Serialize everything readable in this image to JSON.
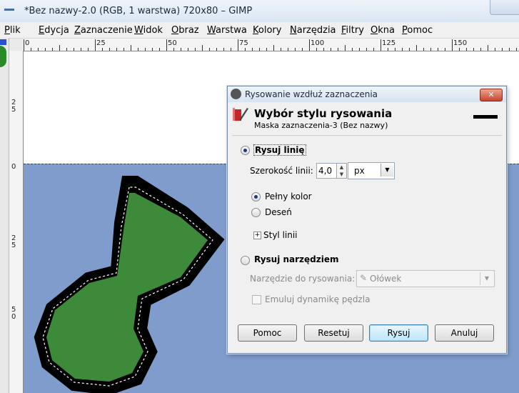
{
  "window": {
    "title": "*Bez nazwy-2.0 (RGB, 1 warstwa) 720x80 – GIMP"
  },
  "menu": [
    {
      "label": "Plik",
      "u": "P"
    },
    {
      "label": "Edycja",
      "u": "E"
    },
    {
      "label": "Zaznaczenie",
      "u": "Z"
    },
    {
      "label": "Widok",
      "u": "W"
    },
    {
      "label": "Obraz",
      "u": "O"
    },
    {
      "label": "Warstwa",
      "u": "W"
    },
    {
      "label": "Kolory",
      "u": "K"
    },
    {
      "label": "Narzędzia",
      "u": "N"
    },
    {
      "label": "Filtry",
      "u": "F"
    },
    {
      "label": "Okna",
      "u": "O"
    },
    {
      "label": "Pomoc",
      "u": "P"
    }
  ],
  "ruler_top": [
    "0",
    "25",
    "50",
    "75",
    "100",
    "125",
    "150"
  ],
  "ruler_left": [
    "0",
    "2\n5",
    "5\n0"
  ],
  "ruler_left_top": [
    "2\n5"
  ],
  "colors": {
    "image_bg": "#7f9ccc",
    "shape_fill": "#3d8a3b",
    "outline": "#000000"
  },
  "dialog": {
    "title": "Rysowanie wzdłuż zaznaczenia",
    "close_icon": "close-icon",
    "header_title": "Wybór stylu rysowania",
    "header_subtitle": "Maska zaznaczenia-3 (Bez nazwy)",
    "stroke_line": {
      "label": "Rysuj linię",
      "selected": true
    },
    "width_label": "Szerokość linii:",
    "width_value": "4,0",
    "unit": "px",
    "solid_color": {
      "label": "Pełny kolor",
      "selected": true
    },
    "pattern": {
      "label": "Deseń",
      "selected": false
    },
    "line_style": "Styl linii",
    "stroke_tool": {
      "label": "Rysuj narzędziem",
      "selected": false
    },
    "tool_label": "Narzędzie do rysowania:",
    "tool_value": "Ołówek",
    "emulate": {
      "label": "Emuluj dynamikę pędzla",
      "checked": false
    },
    "buttons": {
      "help": "Pomoc",
      "reset": "Resetuj",
      "stroke": "Rysuj",
      "cancel": "Anuluj"
    }
  }
}
